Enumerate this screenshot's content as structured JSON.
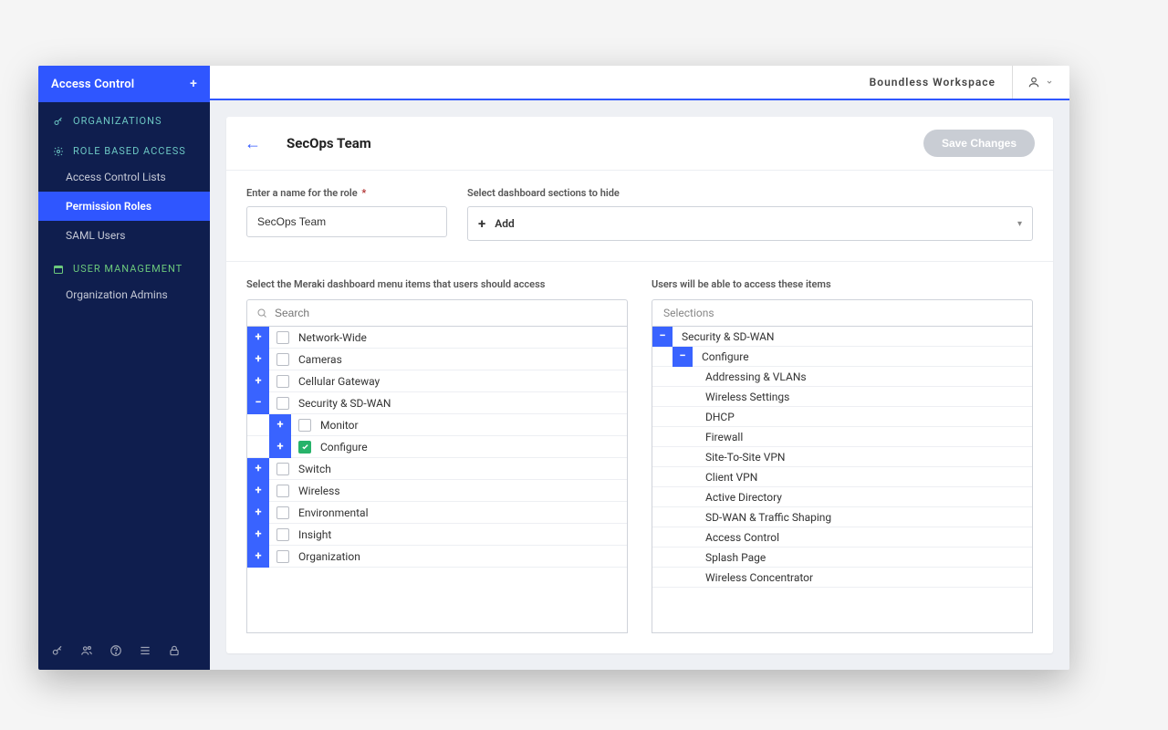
{
  "colors": {
    "brand": "#2f56ff",
    "sidebar_bg": "#0f1e4e",
    "success": "#27b36a"
  },
  "sidebar": {
    "header": "Access Control",
    "add_icon": "+",
    "sections": [
      {
        "icon": "key-icon",
        "label": "ORGANIZATIONS",
        "items": []
      },
      {
        "icon": "gear-icon",
        "label": "ROLE BASED ACCESS",
        "items": [
          {
            "label": "Access Control Lists",
            "active": false
          },
          {
            "label": "Permission Roles",
            "active": true
          },
          {
            "label": "SAML Users",
            "active": false
          }
        ]
      },
      {
        "icon": "calendar-icon",
        "label": "USER MANAGEMENT",
        "items": [
          {
            "label": "Organization Admins",
            "active": false
          }
        ]
      }
    ],
    "footer_icons": [
      "key-icon",
      "users-icon",
      "help-icon",
      "list-icon",
      "lock-icon"
    ]
  },
  "topbar": {
    "workspace": "Boundless Workspace"
  },
  "page": {
    "title": "SecOps Team",
    "save_label": "Save Changes",
    "name_label": "Enter a name for the role",
    "name_value": "SecOps Team",
    "hide_label": "Select dashboard sections to hide",
    "add_label": "Add",
    "left_col_label": "Select the Meraki dashboard menu items that users should access",
    "right_col_label": "Users will be able to access these items",
    "search_placeholder": "Search",
    "selections_header": "Selections"
  },
  "menu_tree": [
    {
      "label": "Network-Wide",
      "toggle": "+",
      "checked": false
    },
    {
      "label": "Cameras",
      "toggle": "+",
      "checked": false
    },
    {
      "label": "Cellular Gateway",
      "toggle": "+",
      "checked": false
    },
    {
      "label": "Security & SD-WAN",
      "toggle": "-",
      "checked": false,
      "children": [
        {
          "label": "Monitor",
          "toggle": "+",
          "checked": false
        },
        {
          "label": "Configure",
          "toggle": "+",
          "checked": true
        }
      ]
    },
    {
      "label": "Switch",
      "toggle": "+",
      "checked": false
    },
    {
      "label": "Wireless",
      "toggle": "+",
      "checked": false
    },
    {
      "label": "Environmental",
      "toggle": "+",
      "checked": false
    },
    {
      "label": "Insight",
      "toggle": "+",
      "checked": false
    },
    {
      "label": "Organization",
      "toggle": "+",
      "checked": false
    }
  ],
  "selections_tree": {
    "root": {
      "label": "Security & SD-WAN",
      "toggle": "-"
    },
    "group": {
      "label": "Configure",
      "toggle": "-"
    },
    "items": [
      "Addressing & VLANs",
      "Wireless Settings",
      "DHCP",
      "Firewall",
      "Site-To-Site VPN",
      "Client VPN",
      "Active Directory",
      "SD-WAN & Traffic Shaping",
      "Access Control",
      "Splash Page",
      "Wireless Concentrator"
    ]
  }
}
